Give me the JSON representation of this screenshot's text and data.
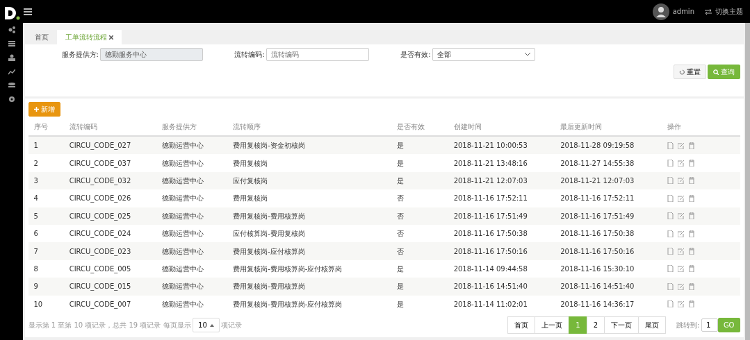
{
  "header": {
    "user": "admin",
    "theme_switch": "切换主题"
  },
  "sidebar": {
    "items": [
      {
        "kind": "nodes"
      },
      {
        "kind": "list"
      },
      {
        "kind": "group"
      },
      {
        "kind": "chart"
      },
      {
        "kind": "stack"
      },
      {
        "kind": "gear"
      }
    ]
  },
  "tabs": [
    {
      "label": "首页",
      "selected": false,
      "closable": false
    },
    {
      "label": "工单流转流程",
      "selected": true,
      "closable": true
    }
  ],
  "filters": [
    {
      "label": "服务提供方:",
      "kind": "readonly",
      "value": "德勤服务中心"
    },
    {
      "label": "流转编码:",
      "kind": "text",
      "placeholder": "流转编码"
    },
    {
      "label": "是否有效:",
      "kind": "select",
      "value": "全部"
    }
  ],
  "filter_buttons": [
    {
      "label": "重置",
      "kind": "reset"
    },
    {
      "label": "查询",
      "kind": "search"
    }
  ],
  "add_button": "新增",
  "table": {
    "columns": [
      "序号",
      "流转编码",
      "服务提供方",
      "流转顺序",
      "是否有效",
      "创建时间",
      "最后更新时间",
      "操作"
    ],
    "rows": [
      [
        "1",
        "CIRCU_CODE_027",
        "德勤运营中心",
        "费用复核岗-资金初核岗",
        "是",
        "2018-11-21 10:00:53",
        "2018-11-28 09:19:58"
      ],
      [
        "2",
        "CIRCU_CODE_037",
        "德勤运营中心",
        "费用复核岗",
        "是",
        "2018-11-21 13:48:16",
        "2018-11-27 14:55:38"
      ],
      [
        "3",
        "CIRCU_CODE_032",
        "德勤运营中心",
        "应付复核岗",
        "是",
        "2018-11-21 12:07:03",
        "2018-11-21 12:07:03"
      ],
      [
        "4",
        "CIRCU_CODE_026",
        "德勤运营中心",
        "费用复核岗",
        "否",
        "2018-11-16 17:52:11",
        "2018-11-16 17:52:11"
      ],
      [
        "5",
        "CIRCU_CODE_025",
        "德勤运营中心",
        "费用复核岗-费用核算岗",
        "否",
        "2018-11-16 17:51:49",
        "2018-11-16 17:51:49"
      ],
      [
        "6",
        "CIRCU_CODE_024",
        "德勤运营中心",
        "应付核算岗-费用复核岗",
        "否",
        "2018-11-16 17:50:38",
        "2018-11-16 17:50:38"
      ],
      [
        "7",
        "CIRCU_CODE_023",
        "德勤运营中心",
        "费用复核岗-应付核算岗",
        "否",
        "2018-11-16 17:50:16",
        "2018-11-16 17:50:16"
      ],
      [
        "8",
        "CIRCU_CODE_005",
        "德勤运营中心",
        "费用复核岗-费用核算岗-应付核算岗",
        "是",
        "2018-11-14 09:44:58",
        "2018-11-16 15:30:10"
      ],
      [
        "9",
        "CIRCU_CODE_015",
        "德勤运营中心",
        "费用复核岗-费用核算岗",
        "是",
        "2018-11-16 14:51:40",
        "2018-11-16 14:51:40"
      ],
      [
        "10",
        "CIRCU_CODE_007",
        "德勤运营中心",
        "费用复核岗-费用核算岗-应付核算岗",
        "是",
        "2018-11-14 11:02:01",
        "2018-11-16 14:36:17"
      ]
    ]
  },
  "footer": {
    "summary": "显示第 1 至第 10 项记录，总共 19 项记录 每页显示",
    "page_size": "10",
    "suffix": "项记录"
  },
  "pagination": [
    {
      "label": "首页",
      "selected": false
    },
    {
      "label": "上一页",
      "selected": false
    },
    {
      "label": "1",
      "selected": true
    },
    {
      "label": "2",
      "selected": false
    },
    {
      "label": "下一页",
      "selected": false
    },
    {
      "label": "尾页",
      "selected": false
    }
  ],
  "jump": {
    "label": "跳转到:",
    "value": "1",
    "button": "GO"
  }
}
